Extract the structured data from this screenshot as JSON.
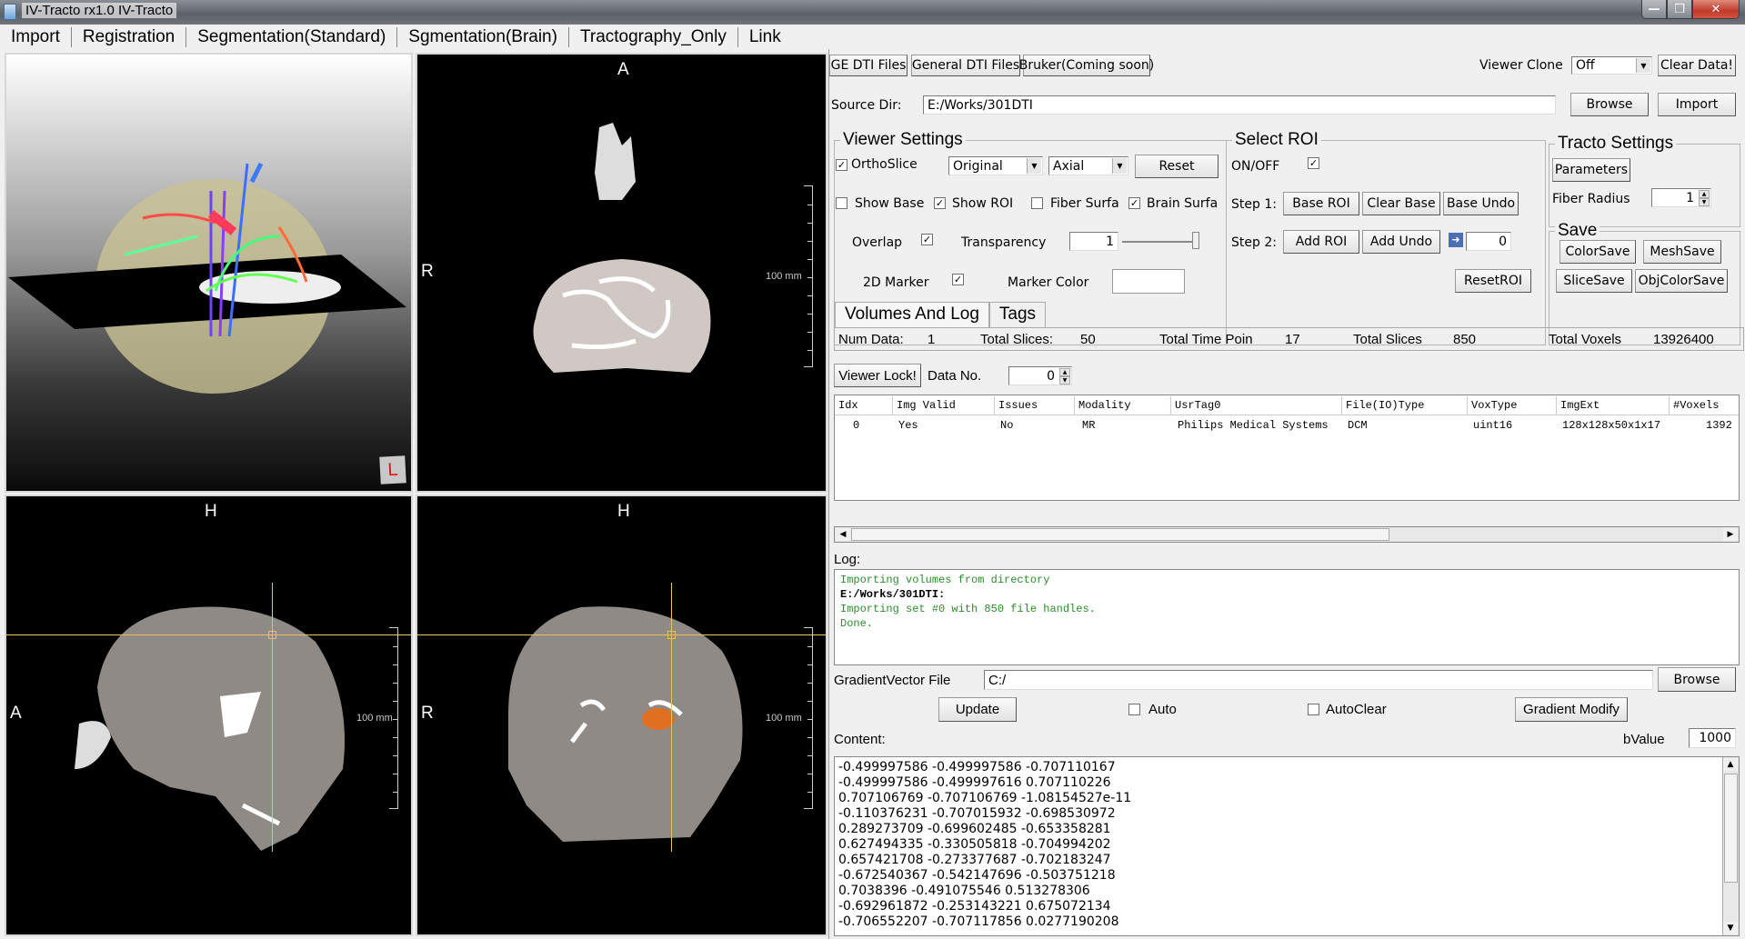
{
  "window": {
    "title": "IV-Tracto rx1.0 IV-Tracto",
    "controls": {
      "minimize": "—",
      "restore": "❐",
      "close": "✕"
    }
  },
  "menu": [
    "Import",
    "Registration",
    "Segmentation(Standard)",
    "Sgmentation(Brain)",
    "Tractography_Only",
    "Link"
  ],
  "viewers": {
    "view3d": {
      "orientation_marker": "L"
    },
    "axial": {
      "top": "A",
      "left": "R",
      "scale": "100 mm"
    },
    "sagittal": {
      "top": "H",
      "left": "A",
      "scale": "100 mm"
    },
    "coronal": {
      "top": "H",
      "left": "R",
      "scale": "100 mm"
    }
  },
  "import_toolbar": {
    "ge_dti": "GE DTI Files",
    "general_dti": "General DTI Files",
    "bruker": "Bruker(Coming soon)",
    "viewer_clone_label": "Viewer Clone",
    "viewer_clone_value": "Off",
    "clear_data": "Clear Data!",
    "source_dir_label": "Source Dir:",
    "source_dir_value": "E:/Works/301DTI",
    "browse": "Browse",
    "import": "Import"
  },
  "viewer_settings": {
    "title": "Viewer Settings",
    "orthoslice": {
      "label": "OrthoSlice",
      "checked": true
    },
    "mode_select": "Original",
    "plane_select": "Axial",
    "reset": "Reset",
    "show_base": {
      "label": "Show Base",
      "checked": false
    },
    "show_roi": {
      "label": "Show ROI",
      "checked": true
    },
    "fiber_surface": {
      "label": "Fiber Surfa",
      "checked": false
    },
    "brain_surface": {
      "label": "Brain Surfa",
      "checked": true
    },
    "overlap": {
      "label": "Overlap",
      "checked": true
    },
    "transparency_label": "Transparency",
    "transparency_value": "1",
    "transparency_slider": 1.0,
    "marker_2d": {
      "label": "2D Marker",
      "checked": true
    },
    "marker_color_label": "Marker Color",
    "marker_color": "#ffffff"
  },
  "select_roi": {
    "title": "Select ROI",
    "on_off": {
      "label": "ON/OFF",
      "checked": true
    },
    "step1_label": "Step 1:",
    "base_roi": "Base ROI",
    "clear_base": "Clear Base",
    "base_undo": "Base Undo",
    "step2_label": "Step 2:",
    "add_roi": "Add ROI",
    "add_undo": "Add Undo",
    "roi_index": "0",
    "reset_roi": "ResetROI"
  },
  "tracto_settings": {
    "title": "Tracto Settings",
    "parameters": "Parameters",
    "fiber_radius_label": "Fiber Radius",
    "fiber_radius_value": "1"
  },
  "save": {
    "title": "Save",
    "color_save": "ColorSave",
    "mesh_save": "MeshSave",
    "slice_save": "SliceSave",
    "obj_color_save": "ObjColorSave"
  },
  "tabs": [
    {
      "label": "Volumes And Log",
      "active": true
    },
    {
      "label": "Tags",
      "active": false
    }
  ],
  "stats": {
    "num_data_label": "Num Data:",
    "num_data": "1",
    "total_slices_label": "Total Slices:",
    "total_slices": "50",
    "total_time_label": "Total Time Poin",
    "total_time": "17",
    "total_slices2_label": "Total Slices",
    "total_slices2": "850",
    "total_voxels_label": "Total Voxels",
    "total_voxels": "13926400"
  },
  "viewer_lock": "Viewer Lock!",
  "data_no_label": "Data No.",
  "data_no_value": "0",
  "table": {
    "columns": [
      "Idx",
      "Img Valid",
      "Issues",
      "Modality",
      "UsrTag0",
      "File(IO)Type",
      "VoxType",
      "ImgExt",
      "#Voxels"
    ],
    "rows": [
      [
        "0",
        "Yes",
        "No",
        "MR",
        "Philips Medical Systems",
        "DCM",
        "uint16",
        "128x128x50x1x17",
        "1392"
      ]
    ]
  },
  "log": {
    "label": "Log:",
    "lines": [
      {
        "text": "Importing volumes from directory",
        "color": "#2e8b2e"
      },
      {
        "text": "E:/Works/301DTI:",
        "color": "#000000",
        "bold": true
      },
      {
        "text": "Importing set #0 with 850 file handles.",
        "color": "#2e8b2e"
      },
      {
        "text": "Done.",
        "color": "#2e8b2e"
      }
    ]
  },
  "gradient": {
    "file_label": "GradientVector File",
    "file_value": "C:/",
    "browse": "Browse",
    "update": "Update",
    "auto": {
      "label": "Auto",
      "checked": false
    },
    "auto_clear": {
      "label": "AutoClear",
      "checked": false
    },
    "gradient_modify": "Gradient Modify",
    "content_label": "Content:",
    "bvalue_label": "bValue",
    "bvalue": "1000",
    "content_lines": [
      "-0.499997586 -0.499997586 -0.707110167",
      "-0.499997586 -0.499997616 0.707110226",
      "0.707106769 -0.707106769 -1.08154527e-11",
      "-0.110376231 -0.707015932 -0.698530972",
      "0.289273709 -0.699602485 -0.653358281",
      "0.627494335 -0.330505818 -0.704994202",
      "0.657421708 -0.273377687 -0.702183247",
      "-0.672540367 -0.542147696 -0.503751218",
      "0.7038396 -0.491075546 0.513278306",
      "-0.692961872 -0.253143221 0.675072134",
      "-0.706552207 -0.707117856 0.0277190208"
    ]
  }
}
